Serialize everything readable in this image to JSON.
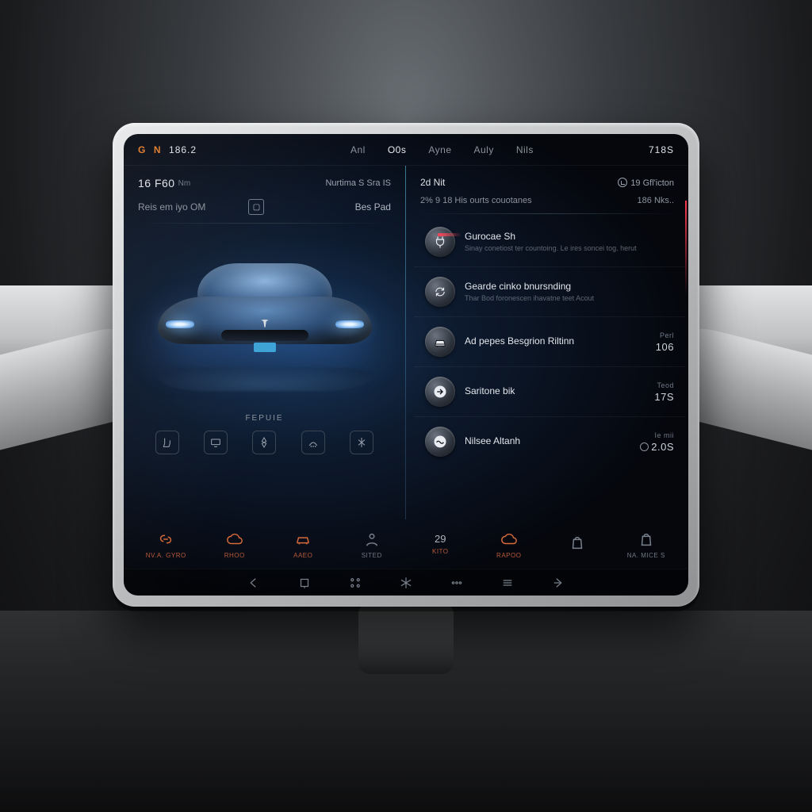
{
  "topbar": {
    "badge_g": "G",
    "badge_n": "N",
    "number": "186.2",
    "tabs": [
      "Anl",
      "O0s",
      "Ayne",
      "Auly",
      "Nils"
    ],
    "active_tab_index": 1,
    "right": "718S"
  },
  "left": {
    "header_main": "16 F60",
    "header_unit": "Nm",
    "header_right": "Nurtima S Sra IS",
    "row2_label": "Reis em iyo OM",
    "row2_icon": "box-icon",
    "row2_right": "Bes Pad",
    "section_label": "FEPUIE",
    "quick_icons": [
      "seat-icon",
      "display-icon",
      "fan-icon",
      "defrost-icon",
      "mode-icon"
    ]
  },
  "right": {
    "header_main": "2d Nit",
    "header_right_icon": "clock-icon",
    "header_right": "19 Gfl'icton",
    "sub_left": "2% 9 18 His ourts couotanes",
    "sub_right": "186 Nks..",
    "items": [
      {
        "icon": "plug-icon",
        "title": "Gurocae Sh",
        "desc": "Sinay conetiost ter countoing. Le ires soncei tog. herut",
        "value": "",
        "small": "",
        "accent": "red"
      },
      {
        "icon": "loop-icon",
        "title": "Gearde cinko bnursnding",
        "desc": "Thar Bod  foronescen ihavatne teet Acout",
        "value": "",
        "small": ""
      },
      {
        "icon": "car-icon",
        "title": "Ad pepes Besgrion Riltinn",
        "desc": "",
        "value": "106",
        "small": "Perl"
      },
      {
        "icon": "arrow-icon",
        "title": "Saritone bik",
        "desc": "",
        "value": "17S",
        "small": "Teod"
      },
      {
        "icon": "wave-icon",
        "title": "Nilsee Altanh",
        "desc": "",
        "value": "2.0S",
        "small": "Ie mii",
        "circle": true
      }
    ]
  },
  "nav": [
    {
      "icon": "link-icon",
      "label": "NV.A. GYRO",
      "tint": "orange"
    },
    {
      "icon": "cloud-icon",
      "label": "RHOO",
      "tint": "orange"
    },
    {
      "icon": "car2-icon",
      "label": "AAEO",
      "tint": "orange"
    },
    {
      "icon": "person-icon",
      "label": "SITED",
      "tint": "grey"
    },
    {
      "text": "29",
      "label": "KITO",
      "tint": "orange"
    },
    {
      "icon": "cloud-icon",
      "label": "RAPOO",
      "tint": "orange"
    },
    {
      "icon": "bag-icon",
      "label": "",
      "tint": "grey"
    },
    {
      "icon": "bag-icon",
      "label": "NA. MICE S",
      "tint": "grey"
    }
  ],
  "sysbar_icons": [
    "back-icon",
    "square-icon",
    "apps-icon",
    "snow-icon",
    "more-icon",
    "burger-icon",
    "forward-icon"
  ]
}
